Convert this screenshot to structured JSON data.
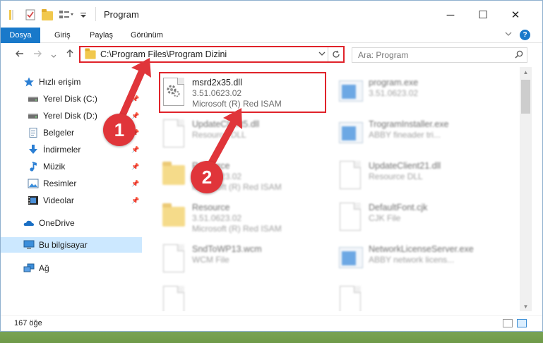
{
  "window": {
    "title": "Program",
    "controls": {
      "minimize": "─",
      "maximize": "☐",
      "close": "✕"
    }
  },
  "ribbon": {
    "tabs": [
      {
        "label": "Dosya",
        "active": true
      },
      {
        "label": "Giriş"
      },
      {
        "label": "Paylaş"
      },
      {
        "label": "Görünüm"
      }
    ],
    "expand_icon": "chevron-down-icon",
    "help_label": "?"
  },
  "nav": {
    "address_path": "C:\\Program Files\\Program Dizini",
    "search_placeholder": "Ara: Program"
  },
  "sidebar": {
    "items": [
      {
        "label": "Hızlı erişim",
        "icon": "star-icon"
      },
      {
        "label": "Yerel Disk (C:)",
        "icon": "drive-icon",
        "pinned": true
      },
      {
        "label": "Yerel Disk (D:)",
        "icon": "drive-icon",
        "pinned": true
      },
      {
        "label": "Belgeler",
        "icon": "documents-icon",
        "pinned": true
      },
      {
        "label": "İndirmeler",
        "icon": "download-icon",
        "pinned": true
      },
      {
        "label": "Müzik",
        "icon": "music-icon",
        "pinned": true
      },
      {
        "label": "Resimler",
        "icon": "pictures-icon",
        "pinned": true
      },
      {
        "label": "Videolar",
        "icon": "videos-icon",
        "pinned": true
      },
      {
        "label": "OneDrive",
        "icon": "cloud-icon"
      },
      {
        "label": "Bu bilgisayar",
        "icon": "computer-icon",
        "selected": true
      },
      {
        "label": "Ağ",
        "icon": "network-icon"
      }
    ]
  },
  "files": [
    {
      "name": "msrd2x35.dll",
      "line2": "3.51.0623.02",
      "line3": "Microsoft (R) Red ISAM",
      "icon": "dll-gear-icon",
      "highlighted": true
    },
    {
      "name": "program.exe",
      "line2": "3.51.0623.02",
      "line3": "",
      "icon": "exe-icon"
    },
    {
      "name": "UpdateClient5.dll",
      "line2": "Resource DLL",
      "line3": "",
      "icon": "dll-gear-icon"
    },
    {
      "name": "TrogramInstaller.exe",
      "line2": "ABBY fineader tri...",
      "line3": "",
      "icon": "exe-icon"
    },
    {
      "name": "Resource",
      "line2": "3.51.0623.02",
      "line3": "Microsoft (R) Red ISAM",
      "icon": "folder-icon"
    },
    {
      "name": "UpdateClient21.dll",
      "line2": "Resource DLL",
      "line3": "",
      "icon": "dll-gear-icon"
    },
    {
      "name": "Resource",
      "line2": "3.51.0623.02",
      "line3": "Microsoft (R) Red ISAM",
      "icon": "folder-icon"
    },
    {
      "name": "DefaultFont.cjk",
      "line2": "CJK File",
      "line3": "",
      "icon": "file-icon"
    },
    {
      "name": "SndToWP13.wcm",
      "line2": "WCM File",
      "line3": "",
      "icon": "file-icon"
    },
    {
      "name": "NetworkLicenseServer.exe",
      "line2": "ABBY network licens...",
      "line3": "",
      "icon": "exe-icon"
    }
  ],
  "status": {
    "item_count": "167 öğe"
  },
  "annotations": [
    {
      "label": "1"
    },
    {
      "label": "2"
    }
  ],
  "colors": {
    "accent": "#1979ca",
    "highlight": "#e0232a",
    "selected": "#cce8ff"
  }
}
